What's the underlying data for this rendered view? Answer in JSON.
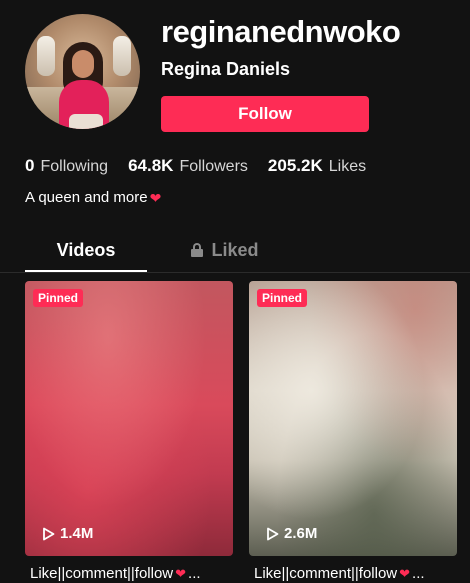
{
  "profile": {
    "username": "reginanednwoko",
    "nickname": "Regina Daniels",
    "follow_label": "Follow",
    "bio_text": "A queen and more",
    "bio_emoji": "❤"
  },
  "stats": {
    "following_count": "0",
    "following_label": "Following",
    "followers_count": "64.8K",
    "followers_label": "Followers",
    "likes_count": "205.2K",
    "likes_label": "Likes"
  },
  "tabs": {
    "videos": "Videos",
    "liked": "Liked"
  },
  "videos": [
    {
      "badge": "Pinned",
      "views": "1.4M",
      "caption": "Like||comment||follow",
      "emoji": "❤",
      "ellipsis": "..."
    },
    {
      "badge": "Pinned",
      "views": "2.6M",
      "caption": "Like||comment||follow",
      "emoji": "❤",
      "ellipsis": "..."
    }
  ],
  "colors": {
    "background": "#121212",
    "accent": "#fe2c55",
    "muted": "#8a8a8a"
  },
  "icons": [
    "play-icon",
    "lock-icon",
    "heart-emoji"
  ]
}
